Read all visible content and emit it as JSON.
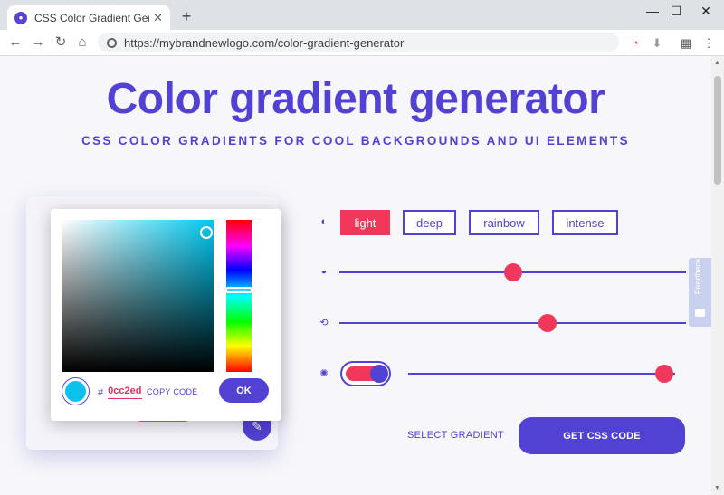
{
  "browser": {
    "tab_title": "CSS Color Gradient Generator",
    "tab_close": "✕",
    "new_tab": "+",
    "url": "https://mybrandnewlogo.com/color-gradient-generator",
    "window_controls": {
      "minimize": "—",
      "maximize": "☐",
      "close": "✕"
    },
    "nav": {
      "back": "←",
      "forward": "→",
      "reload": "↻",
      "home": "⌂"
    },
    "menu": "⋮"
  },
  "hero": {
    "title": "Color gradient generator",
    "subtitle": "CSS COLOR GRADIENTS FOR COOL BACKGROUNDS AND UI ELEMENTS"
  },
  "color_picker": {
    "hash": "#",
    "hex_value": "0cc2ed",
    "copy_label": "COPY CODE",
    "ok_label": "OK",
    "selected_color": "#0cc2ed"
  },
  "modes": [
    {
      "label": "light",
      "active": true
    },
    {
      "label": "deep",
      "active": false
    },
    {
      "label": "rainbow",
      "active": false
    },
    {
      "label": "intense",
      "active": false
    }
  ],
  "sliders": {
    "slider_1_value": 0.5,
    "slider_2_value": 0.6,
    "slider_3_value": 0.96
  },
  "toggle": {
    "on": true
  },
  "actions": {
    "select_gradient": "SELECT GRADIENT",
    "get_css": "GET CSS CODE"
  },
  "feedback_label": "Feedback",
  "colors": {
    "brand": "#5142d3",
    "accent": "#f2385a"
  },
  "icons": {
    "contrast": "◐",
    "drop": "◒",
    "rotate": "⟲",
    "sun": "✺",
    "edit": "✎"
  }
}
